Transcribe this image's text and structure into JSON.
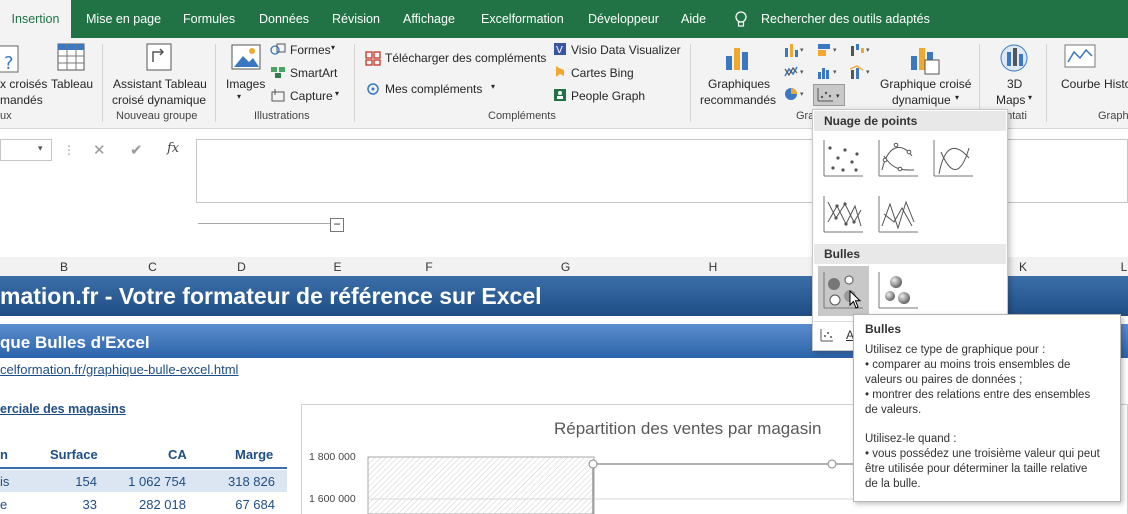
{
  "tabs": [
    "Insertion",
    "Mise en page",
    "Formules",
    "Données",
    "Révision",
    "Affichage",
    "Excelformation",
    "Développeur",
    "Aide"
  ],
  "search_hint": "Rechercher des outils adaptés",
  "ribbon": {
    "pivot_partial": "x croisés",
    "pivot_partial2": "mandés",
    "table": "Tableau",
    "assistant_line1": "Assistant Tableau",
    "assistant_line2": "croisé dynamique",
    "images": "Images",
    "formes": "Formes",
    "smartart": "SmartArt",
    "capture": "Capture",
    "telecharger": "Télécharger des compléments",
    "mes_complements": "Mes compléments",
    "visio": "Visio Data Visualizer",
    "bing": "Cartes Bing",
    "people": "People Graph",
    "graph_rec_line1": "Graphiques",
    "graph_rec_line2": "recommandés",
    "graph_croise_line1": "Graphique croisé",
    "graph_croise_line2": "dynamique",
    "maps_line1": "3D",
    "maps_line2": "Maps",
    "courbe": "Courbe",
    "histo": "Histo",
    "groups": {
      "tableaux_partial": "ux",
      "nouveau_groupe": "Nouveau groupe",
      "illustrations": "Illustrations",
      "complements": "Compléments",
      "graphiques_partial": "Gra",
      "presentations_partial": "entati",
      "graph_right_partial": "Graph"
    }
  },
  "formula": {
    "fx": "fx"
  },
  "columns": [
    "B",
    "C",
    "D",
    "E",
    "F",
    "G",
    "H",
    "K",
    "L"
  ],
  "sheet": {
    "banner_title": "mation.fr - Votre formateur de référence sur Excel",
    "subtitle": "que Bulles d'Excel",
    "link": "celformation.fr/graphique-bulle-excel.html",
    "section": "erciale des magasins",
    "headers": [
      "n",
      "Surface",
      "CA",
      "Marge"
    ],
    "rows": [
      [
        "is",
        "154",
        "1 062 754",
        "318 826"
      ],
      [
        "e",
        "33",
        "282 018",
        "67 684"
      ]
    ],
    "chart_title": "Répartition des ventes par magasin",
    "y_ticks": [
      "1 800 000",
      "1 600 000"
    ]
  },
  "dropdown": {
    "section_points": "Nuage de points",
    "section_bulles": "Bulles",
    "more_partial": "A"
  },
  "tooltip": {
    "title": "Bulles",
    "p1": "Utilisez ce type de graphique pour :",
    "b1a": "• comparer au moins trois ensembles de",
    "b1b": "valeurs ou paires de données ;",
    "b2a": "• montrer des relations entre des ensembles",
    "b2b": "de valeurs.",
    "p2": "Utilisez-le quand :",
    "b3a": "• vous possédez une troisième valeur qui peut",
    "b3b": "être utilisée pour déterminer la taille relative",
    "b3c": "de la bulle."
  },
  "colors": {
    "excel_green": "#217346",
    "banner_blue": "#2c5f99"
  }
}
